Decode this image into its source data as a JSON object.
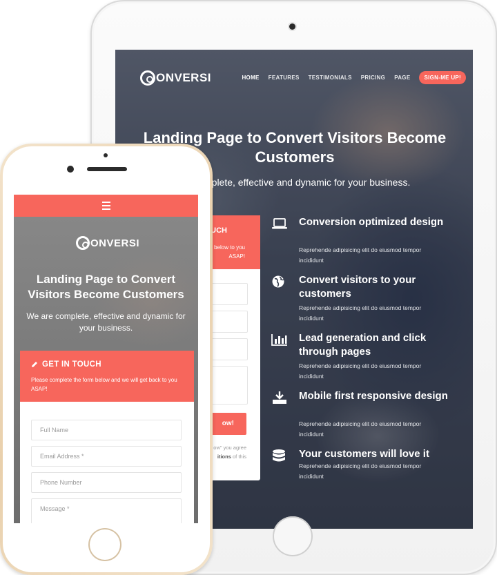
{
  "tablet": {
    "brand": "ONVERSI",
    "nav": {
      "items": [
        "HOME",
        "FEATURES",
        "TESTIMONIALS",
        "PRICING",
        "PAGE"
      ],
      "cta": "SIGN-ME UP!"
    },
    "hero": {
      "title": "Landing Page to Convert Visitors Become Customers",
      "subtitle": "mplete, effective and dynamic for your business."
    },
    "form": {
      "title": "UCH",
      "description": "form below to you ASAP!",
      "button": "ow!",
      "note_prefix": "ow\" you agree",
      "note_bold": "itions",
      "note_suffix": "of this"
    },
    "features": [
      {
        "icon": "laptop-icon",
        "title": "Conversion optimized design",
        "desc": "Reprehende adipisicing elit do eiusmod tempor incididunt"
      },
      {
        "icon": "globe-icon",
        "title": "Convert visitors to your customers",
        "desc": "Reprehende adipisicing elit do eiusmod tempor incididunt"
      },
      {
        "icon": "bar-chart-icon",
        "title": "Lead generation and click through pages",
        "desc": "Reprehende adipisicing elit do eiusmod tempor incididunt"
      },
      {
        "icon": "download-icon",
        "title": "Mobile first responsive design",
        "desc": "Reprehende adipisicing elit do eiusmod tempor incididunt"
      },
      {
        "icon": "database-icon",
        "title": "Your customers will love it",
        "desc": "Reprehende adipisicing elit do eiusmod tempor incididunt"
      }
    ]
  },
  "phone": {
    "brand": "ONVERSI",
    "hero": {
      "title": "Landing Page to Convert Visitors Become Customers",
      "subtitle": "We are complete, effective and dynamic for your business."
    },
    "form": {
      "title": "GET IN TOUCH",
      "description": "Please complete the form below and we will get back to you ASAP!",
      "fields": {
        "full_name": "Full Name",
        "email": "Email Address *",
        "phone": "Phone Number",
        "message": "Message *"
      }
    }
  },
  "colors": {
    "accent": "#f7665c"
  }
}
